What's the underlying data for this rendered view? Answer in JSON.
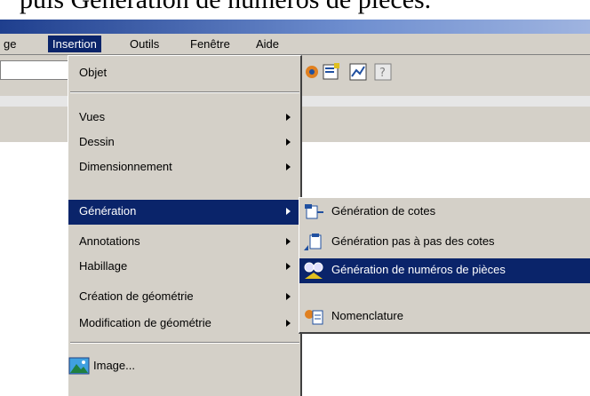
{
  "caption": "puis Génération de numéros de pièces.",
  "menubar": {
    "items": [
      "ge",
      "Insertion",
      "Outils",
      "Fenêtre",
      "Aide"
    ]
  },
  "menu": {
    "items": [
      {
        "label": "Objet",
        "submenu": false
      },
      {
        "label": "Vues",
        "submenu": true
      },
      {
        "label": "Dessin",
        "submenu": true
      },
      {
        "label": "Dimensionnement",
        "submenu": true
      },
      {
        "label": "Génération",
        "submenu": true,
        "highlighted": true
      },
      {
        "label": "Annotations",
        "submenu": true
      },
      {
        "label": "Habillage",
        "submenu": true
      },
      {
        "label": "Création de géométrie",
        "submenu": true
      },
      {
        "label": "Modification de géométrie",
        "submenu": true
      },
      {
        "label": "Image...",
        "submenu": false
      }
    ]
  },
  "submenu": {
    "items": [
      {
        "label": "Génération de cotes",
        "icon": "dimension-generation-icon"
      },
      {
        "label": "Génération pas à pas des cotes",
        "icon": "step-dimension-generation-icon"
      },
      {
        "label": "Génération de numéros de pièces",
        "icon": "balloon-generation-icon",
        "highlighted": true
      },
      {
        "label": "Nomenclature",
        "icon": "bill-of-material-icon"
      }
    ]
  },
  "colors": {
    "menu_bg": "#d4d0c8",
    "highlight": "#0a246a"
  }
}
